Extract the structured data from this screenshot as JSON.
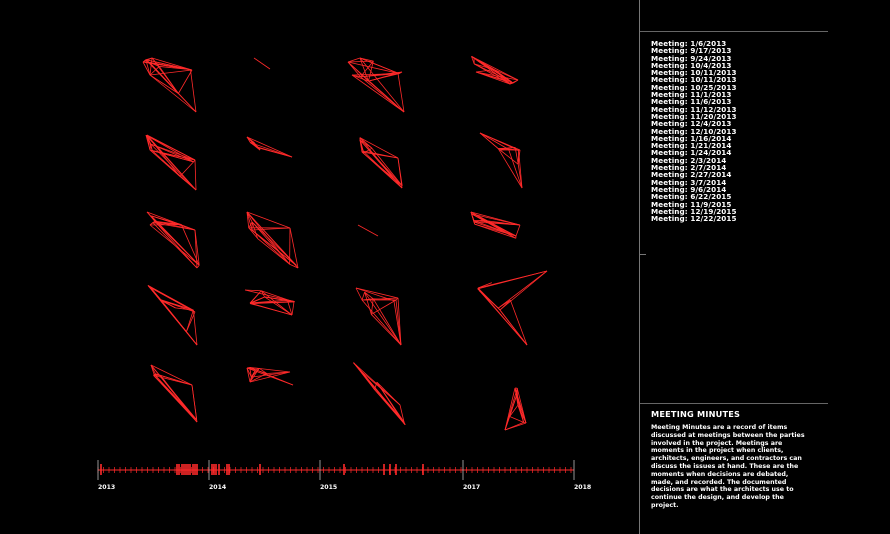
{
  "meetings": [
    "Meeting: 1/6/2013",
    "Meeting: 9/17/2013",
    "Meeting: 9/24/2013",
    "Meeting: 10/4/2013",
    "Meeting: 10/11/2013",
    "Meeting: 10/11/2013",
    "Meeting: 10/25/2013",
    "Meeting: 11/1/2013",
    "Meeting: 11/6/2013",
    "Meeting: 11/12/2013",
    "Meeting: 11/20/2013",
    "Meeting: 12/4/2013",
    "Meeting: 12/10/2013",
    "Meeting: 1/16/2014",
    "Meeting: 1/21/2014",
    "Meeting: 1/24/2014",
    "Meeting: 2/3/2014",
    "Meeting: 2/7/2014",
    "Meeting: 2/27/2014",
    "Meeting: 3/7/2014",
    "Meeting: 9/6/2014",
    "Meeting: 6/22/2015",
    "Meeting: 11/9/2015",
    "Meeting: 12/19/2015",
    "Meeting: 12/22/2015"
  ],
  "info": {
    "title": "MEETING MINUTES",
    "text": "Meeting Minutes are a record of items discussed at meetings between the parties involved in the project. Meetings are moments in the project when clients, architects, engineers, and contractors can discuss the issues at hand. These are the moments when decisions are debated, made, and recorded. The documented decisions are what the architects use to continue the design, and develop the project."
  },
  "timeline": {
    "years": [
      "2013",
      "2014",
      "2015",
      "2017",
      "2018"
    ]
  },
  "colors": {
    "accent": "#ff2a2a",
    "background": "#000000",
    "text": "#ffffff",
    "divider": "#777777"
  }
}
